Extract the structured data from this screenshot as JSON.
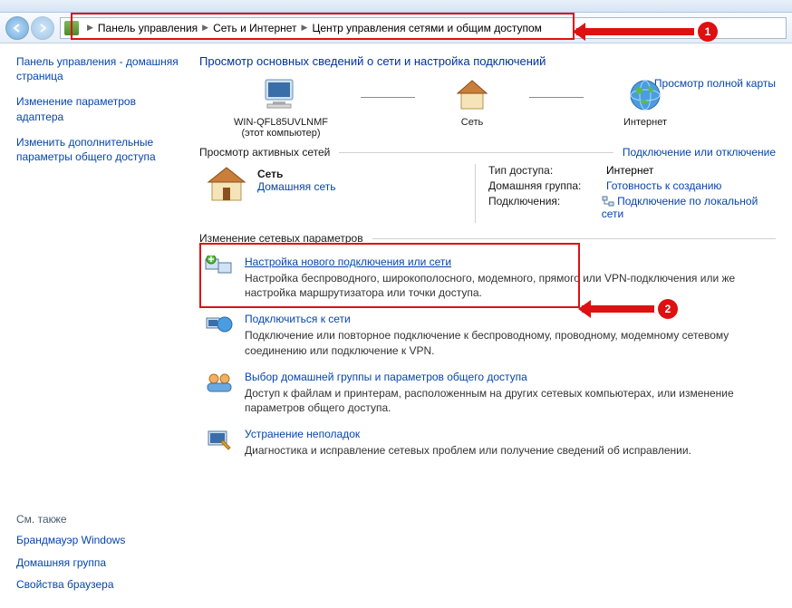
{
  "breadcrumb": {
    "item1": "Панель управления",
    "item2": "Сеть и Интернет",
    "item3": "Центр управления сетями и общим доступом"
  },
  "callouts": {
    "num1": "1",
    "num2": "2"
  },
  "sidebar": {
    "home": "Панель управления - домашняя страница",
    "adapter": "Изменение параметров адаптера",
    "sharing": "Изменить дополнительные параметры общего доступа",
    "see_also": "См. также",
    "firewall": "Брандмауэр Windows",
    "homegroup": "Домашняя группа",
    "browser": "Свойства браузера"
  },
  "main": {
    "title": "Просмотр основных сведений о сети и настройка подключений",
    "viewmap": "Просмотр полной карты",
    "node1_name": "WIN-QFL85UVLNMF",
    "node1_sub": "(этот компьютер)",
    "node2_name": "Сеть",
    "node3_name": "Интернет",
    "active_label": "Просмотр активных сетей",
    "active_link": "Подключение или отключение",
    "net_name": "Сеть",
    "net_type": "Домашняя сеть",
    "row_type_lbl": "Тип доступа:",
    "row_type_val": "Интернет",
    "row_hg_lbl": "Домашняя группа:",
    "row_hg_val": "Готовность к созданию",
    "row_conn_lbl": "Подключения:",
    "row_conn_val": "Подключение по локальной сети",
    "settings_label": "Изменение сетевых параметров",
    "task1_link": "Настройка нового подключения или сети",
    "task1_desc": "Настройка беспроводного, широкополосного, модемного, прямого или VPN-подключения или же настройка маршрутизатора или точки доступа.",
    "task2_link": "Подключиться к сети",
    "task2_desc": "Подключение или повторное подключение к беспроводному, проводному, модемному сетевому соединению или подключение к VPN.",
    "task3_link": "Выбор домашней группы и параметров общего доступа",
    "task3_desc": "Доступ к файлам и принтерам, расположенным на других сетевых компьютерах, или изменение параметров общего доступа.",
    "task4_link": "Устранение неполадок",
    "task4_desc": "Диагностика и исправление сетевых проблем или получение сведений об исправлении."
  }
}
